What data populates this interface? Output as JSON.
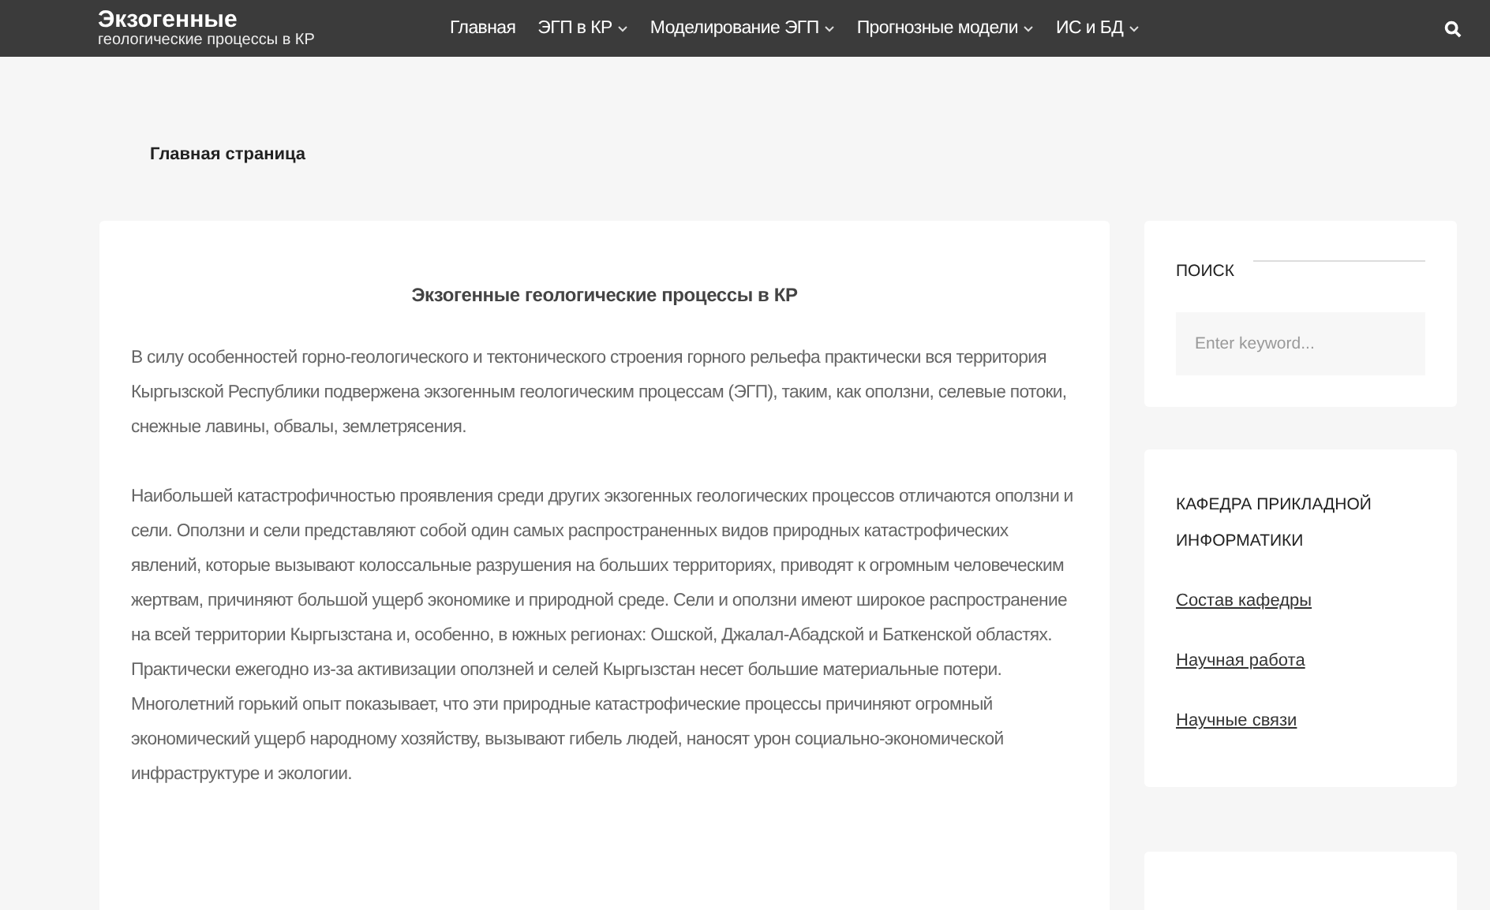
{
  "header": {
    "site_title": "Экзогенные",
    "site_subtitle": "геологические процессы в КР",
    "nav": [
      {
        "label": "Главная",
        "dropdown": false
      },
      {
        "label": "ЭГП в КР",
        "dropdown": true
      },
      {
        "label": "Моделирование ЭГП",
        "dropdown": true
      },
      {
        "label": "Прогнозные модели",
        "dropdown": true
      },
      {
        "label": "ИС и БД",
        "dropdown": true
      }
    ]
  },
  "breadcrumb": "Главная страница",
  "article": {
    "title": "Экзогенные геологические процессы в КР",
    "paragraphs": [
      "В силу особенностей горно-геологического и тектонического строения горного рельефа практически вся территория Кыргызской Республики подвержена экзогенным геологическим процессам (ЭГП), таким, как оползни, селевые потоки, снежные лавины, обвалы, землетрясения.",
      "Наибольшей катастрофичностью проявления среди других экзогенных геологических процессов отличаются оползни и сели. Оползни и сели представляют собой один самых распространенных видов природных катастрофических явлений, которые вызывают колоссальные разрушения на больших территориях, приводят к огромным человеческим жертвам, причиняют большой ущерб экономике и природной среде. Сели и оползни имеют широкое распространение на всей территории Кыргызстана и, особенно, в южных регионах: Ошской, Джалал-Абадской и Баткенской областях. Практически ежегодно из-за активизации оползней и селей Кыргызстан несет большие материальные потери. Многолетний горький опыт показывает, что эти природные катастрофические процессы причиняют огромный экономический ущерб народному хозяйству, вызывают гибель людей, наносят урон социально-экономической инфраструктуре и экологии."
    ]
  },
  "sidebar": {
    "search": {
      "title": "ПОИСК",
      "placeholder": "Enter keyword..."
    },
    "department": {
      "title": "КАФЕДРА ПРИКЛАДНОЙ ИНФОРМАТИКИ",
      "links": [
        "Состав кафедры",
        "Научная работа",
        "Научные связи"
      ]
    }
  }
}
